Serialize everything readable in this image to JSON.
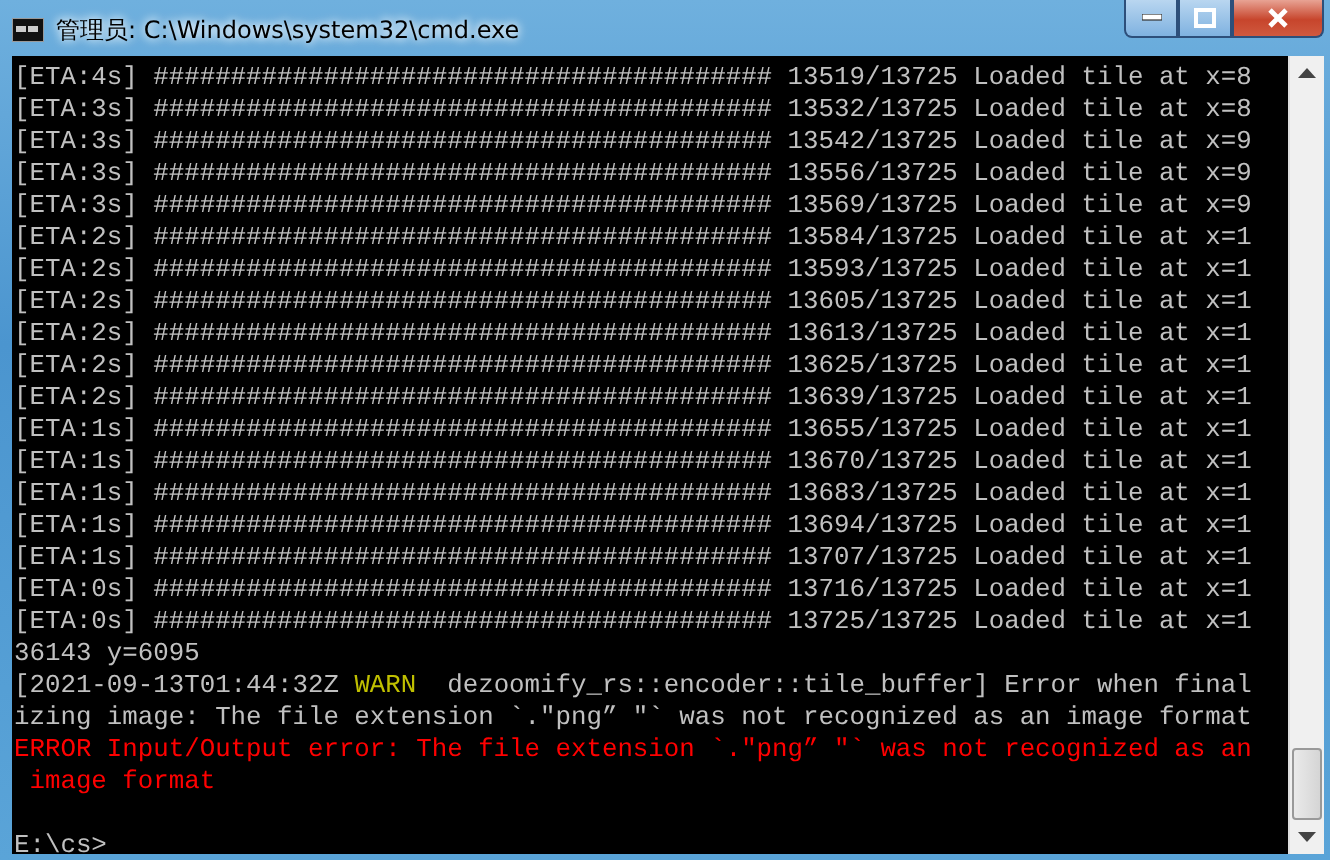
{
  "window": {
    "title": "管理员: C:\\Windows\\system32\\cmd.exe"
  },
  "console": {
    "lines": [
      [
        {
          "kind": "normal",
          "text": "[ETA:4s] ######################################## 13519/13725 Loaded tile at x=8"
        }
      ],
      [
        {
          "kind": "normal",
          "text": "[ETA:3s] ######################################## 13532/13725 Loaded tile at x=8"
        }
      ],
      [
        {
          "kind": "normal",
          "text": "[ETA:3s] ######################################## 13542/13725 Loaded tile at x=9"
        }
      ],
      [
        {
          "kind": "normal",
          "text": "[ETA:3s] ######################################## 13556/13725 Loaded tile at x=9"
        }
      ],
      [
        {
          "kind": "normal",
          "text": "[ETA:3s] ######################################## 13569/13725 Loaded tile at x=9"
        }
      ],
      [
        {
          "kind": "normal",
          "text": "[ETA:2s] ######################################## 13584/13725 Loaded tile at x=1"
        }
      ],
      [
        {
          "kind": "normal",
          "text": "[ETA:2s] ######################################## 13593/13725 Loaded tile at x=1"
        }
      ],
      [
        {
          "kind": "normal",
          "text": "[ETA:2s] ######################################## 13605/13725 Loaded tile at x=1"
        }
      ],
      [
        {
          "kind": "normal",
          "text": "[ETA:2s] ######################################## 13613/13725 Loaded tile at x=1"
        }
      ],
      [
        {
          "kind": "normal",
          "text": "[ETA:2s] ######################################## 13625/13725 Loaded tile at x=1"
        }
      ],
      [
        {
          "kind": "normal",
          "text": "[ETA:2s] ######################################## 13639/13725 Loaded tile at x=1"
        }
      ],
      [
        {
          "kind": "normal",
          "text": "[ETA:1s] ######################################## 13655/13725 Loaded tile at x=1"
        }
      ],
      [
        {
          "kind": "normal",
          "text": "[ETA:1s] ######################################## 13670/13725 Loaded tile at x=1"
        }
      ],
      [
        {
          "kind": "normal",
          "text": "[ETA:1s] ######################################## 13683/13725 Loaded tile at x=1"
        }
      ],
      [
        {
          "kind": "normal",
          "text": "[ETA:1s] ######################################## 13694/13725 Loaded tile at x=1"
        }
      ],
      [
        {
          "kind": "normal",
          "text": "[ETA:1s] ######################################## 13707/13725 Loaded tile at x=1"
        }
      ],
      [
        {
          "kind": "normal",
          "text": "[ETA:0s] ######################################## 13716/13725 Loaded tile at x=1"
        }
      ],
      [
        {
          "kind": "normal",
          "text": "[ETA:0s] ######################################## 13725/13725 Loaded tile at x=1"
        }
      ],
      [
        {
          "kind": "normal",
          "text": "36143 y=6095"
        }
      ],
      [
        {
          "kind": "normal",
          "text": "[2021-09-13T01:44:32Z "
        },
        {
          "kind": "warn",
          "text": "WARN"
        },
        {
          "kind": "normal",
          "text": "  dezoomify_rs::encoder::tile_buffer] Error when final"
        }
      ],
      [
        {
          "kind": "normal",
          "text": "izing image: The file extension `.\"png” \"` was not recognized as an image format"
        }
      ],
      [
        {
          "kind": "error",
          "text": "ERROR Input/Output error: The file extension `.\"png” \"` was not recognized as an"
        }
      ],
      [
        {
          "kind": "error",
          "text": " image format"
        }
      ],
      [
        {
          "kind": "prompt",
          "text": "E:\\cs>"
        }
      ]
    ]
  }
}
